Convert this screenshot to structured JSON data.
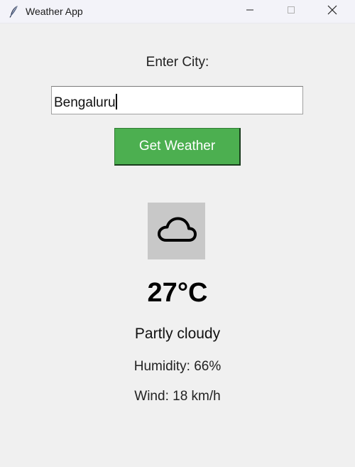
{
  "window": {
    "title": "Weather App",
    "app_icon": "feather-icon",
    "controls": [
      "minimize-icon",
      "maximize-icon",
      "close-icon"
    ]
  },
  "form": {
    "city_label": "Enter City:",
    "city_value": "Bengaluru",
    "button_label": "Get Weather",
    "button_color": "#4caf50"
  },
  "weather": {
    "icon": "cloud-icon",
    "temperature": "27°C",
    "description": "Partly cloudy",
    "humidity": "Humidity: 66%",
    "wind": "Wind: 18 km/h"
  }
}
